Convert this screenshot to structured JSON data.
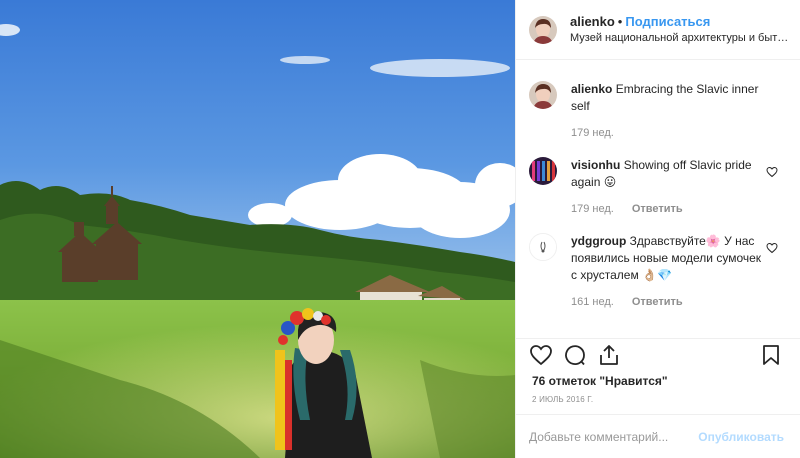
{
  "post": {
    "username": "alienko",
    "separator": "•",
    "follow_label": "Подписаться",
    "location": "Музей национальной архитектуры и быта П..."
  },
  "comments": [
    {
      "user": "alienko",
      "text": "Embracing the Slavic inner self",
      "age": "179 нед.",
      "reply": ""
    },
    {
      "user": "visionhu",
      "text": "Showing off Slavic pride again 😛",
      "age": "179 нед.",
      "reply": "Ответить"
    },
    {
      "user": "ydggroup",
      "text": "Здравствуйте🌸 У нас появились новые модели сумочек с хрусталем 👌🏼💎",
      "age": "161 нед.",
      "reply": "Ответить"
    }
  ],
  "actions": {
    "icons": [
      "heart-icon",
      "comment-icon",
      "share-icon",
      "bookmark-icon"
    ],
    "likes": "76 отметок \"Нравится\"",
    "date": "2 ИЮЛЬ 2016 Г."
  },
  "add_comment": {
    "placeholder": "Добавьте комментарий...",
    "publish_label": "Опубликовать"
  },
  "colors": {
    "link": "#3897f0",
    "publish_disabled": "#b3dbff",
    "muted": "#8e8e8e",
    "text": "#262626"
  }
}
